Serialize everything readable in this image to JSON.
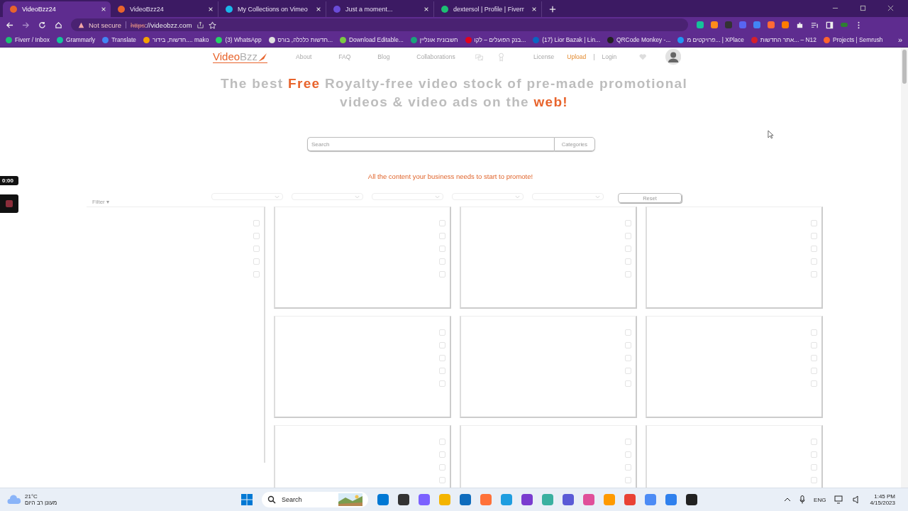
{
  "tabs": [
    {
      "title": "VideoBzz24",
      "selected": true,
      "color": "#e8642c"
    },
    {
      "title": "VideoBzz24",
      "selected": false,
      "color": "#e8642c"
    },
    {
      "title": "My Collections on Vimeo",
      "selected": false,
      "color": "#1ab7ea"
    },
    {
      "title": "Just a moment...",
      "selected": false,
      "color": "#6a4cd8"
    },
    {
      "title": "dextersol | Profile | Fiverr",
      "selected": false,
      "color": "#1dbf73"
    }
  ],
  "address": {
    "security": "Not secure",
    "scheme": "https",
    "rest": "://videobzz.com"
  },
  "bookmarks": [
    {
      "label": "Fiverr / Inbox",
      "color": "#1dbf73"
    },
    {
      "label": "Grammarly",
      "color": "#15c39a"
    },
    {
      "label": "Translate",
      "color": "#4285f4"
    },
    {
      "label": "חדשות, בידור.... mako",
      "color": "#f4a100"
    },
    {
      "label": "(3) WhatsApp",
      "color": "#25d366"
    },
    {
      "label": "חדשות כלכלה, בורס...",
      "color": "#e0e0e0"
    },
    {
      "label": "Download Editable...",
      "color": "#7ac943"
    },
    {
      "label": "חשבונית אונליין",
      "color": "#1aa37a"
    },
    {
      "label": "בנק הפועלים – לקו...",
      "color": "#e3001b"
    },
    {
      "label": "(17) Lior Bazak | Lin...",
      "color": "#0a66c2"
    },
    {
      "label": "QRCode Monkey -...",
      "color": "#222222"
    },
    {
      "label": "פרויקטים מ... | XPlace",
      "color": "#2196f3"
    },
    {
      "label": "אתר החדשות... – N12",
      "color": "#d6202a"
    },
    {
      "label": "Projects | Semrush",
      "color": "#ff642d"
    }
  ],
  "more_bookmarks": "»",
  "site": {
    "logo": {
      "first": "Video",
      "second": "Bzz"
    },
    "nav": [
      {
        "label": "About",
        "highlighted": false
      },
      {
        "label": "FAQ",
        "highlighted": false
      },
      {
        "label": "Blog",
        "highlighted": false
      },
      {
        "label": "Collaborations",
        "highlighted": false
      }
    ],
    "auth": [
      {
        "label": "License",
        "highlighted": false
      },
      {
        "label": "Upload",
        "highlighted": true
      },
      {
        "label": "|",
        "highlighted": false
      },
      {
        "label": "Login",
        "highlighted": false
      }
    ],
    "headline": "The best **Free** Royalty-free video stock of pre-made promotional videos & video ads on the **web!**",
    "search": {
      "placeholder": "Search",
      "button": "Categories"
    },
    "tagline": "All the content your business needs to start to promote!",
    "filter": "Filter ▾",
    "reset": "Reset"
  },
  "recorder": {
    "time": "0:00"
  },
  "taskbar": {
    "temperature": "21°C",
    "weather": "מעונן רב היום",
    "search": "Search",
    "language": "ENG",
    "time": "1:45 PM",
    "date": "4/15/2023"
  }
}
